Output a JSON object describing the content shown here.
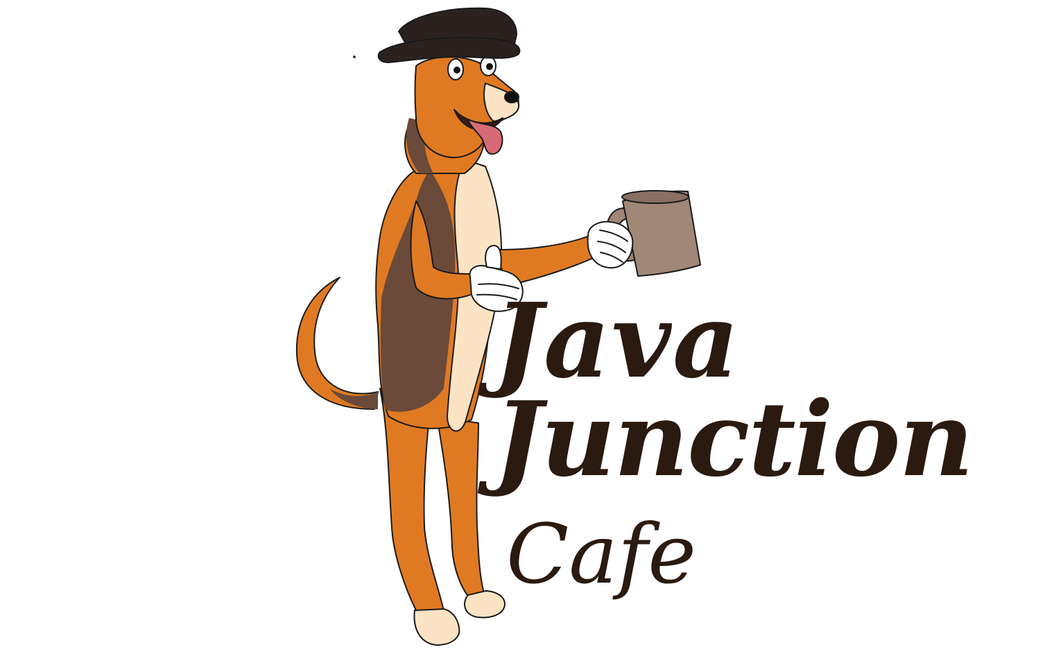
{
  "logo": {
    "line1": "Java",
    "line2": "Junction",
    "line3": "Cafe"
  },
  "colors": {
    "background": "#ffffff",
    "text": "#2a1a10",
    "fur_orange": "#e07a22",
    "fur_brown": "#6b4a3a",
    "fur_cream": "#fbe3c4",
    "hat": "#2b2220",
    "mug": "#a08777",
    "glove": "#ffffff",
    "tongue": "#d86a78",
    "outline": "#1a1a1a"
  },
  "mascot": {
    "description_icons": [
      "dog-mascot-icon",
      "tricorn-hat-icon",
      "coffee-mug-icon",
      "thumbs-up-glove-icon"
    ]
  }
}
